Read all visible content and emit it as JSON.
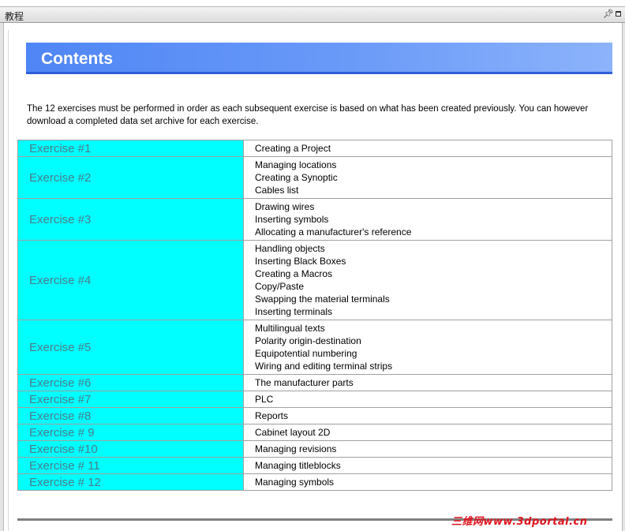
{
  "window": {
    "title": "教程",
    "pin_icon": "pin-icon",
    "maximize_icon": "maximize-icon"
  },
  "banner": {
    "title": "Contents"
  },
  "intro": "The 12 exercises must be performed in order as each subsequent exercise is based on what has been created previously. You can however download a completed data set archive for each exercise.",
  "exercises": [
    {
      "label": "Exercise #1",
      "topics": [
        "Creating a Project"
      ]
    },
    {
      "label": "Exercise #2",
      "topics": [
        "Managing locations",
        "Creating a Synoptic",
        "Cables list"
      ]
    },
    {
      "label": "Exercise #3",
      "topics": [
        "Drawing wires",
        "Inserting symbols",
        "Allocating a manufacturer's reference"
      ]
    },
    {
      "label": "Exercise #4",
      "topics": [
        "Handling objects",
        "Inserting Black Boxes",
        "Creating a Macros",
        "Copy/Paste",
        "Swapping the material terminals",
        "Inserting terminals"
      ]
    },
    {
      "label": "Exercise #5",
      "topics": [
        "Multilingual texts",
        "Polarity origin-destination",
        "Equipotential numbering",
        "Wiring and editing terminal strips"
      ]
    },
    {
      "label": "Exercise #6",
      "topics": [
        "The manufacturer parts"
      ]
    },
    {
      "label": "Exercise #7",
      "topics": [
        "PLC"
      ]
    },
    {
      "label": "Exercise #8",
      "topics": [
        "Reports"
      ]
    },
    {
      "label": "Exercise # 9",
      "topics": [
        "Cabinet layout 2D"
      ]
    },
    {
      "label": "Exercise #10",
      "topics": [
        "Managing revisions"
      ]
    },
    {
      "label": "Exercise # 11",
      "topics": [
        "Managing titleblocks"
      ]
    },
    {
      "label": "Exercise # 12",
      "topics": [
        "Managing symbols"
      ]
    }
  ],
  "watermark": "三维网www.3dportal.cn",
  "colors": {
    "banner": "#4f86f5",
    "exercise_cell": "#00ffff",
    "watermark": "#e0141e"
  }
}
